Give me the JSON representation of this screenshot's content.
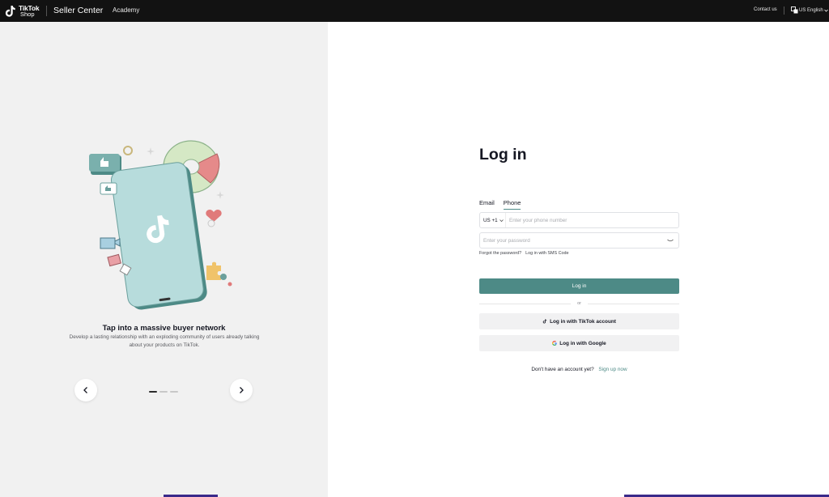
{
  "header": {
    "brand_line1": "TikTok",
    "brand_line2": "Shop",
    "product": "Seller Center",
    "academy": "Academy",
    "contact": "Contact us",
    "language": "US English"
  },
  "carousel": {
    "title": "Tap into a massive buyer network",
    "description": "Develop a lasting relationship with an exploding community of users already talking about your products on TikTok.",
    "prev_icon": "chevron-left-icon",
    "next_icon": "chevron-right-icon",
    "slide_count": 3,
    "active_slide": 1
  },
  "login": {
    "title": "Log in",
    "tabs": [
      {
        "label": "Email",
        "active": false
      },
      {
        "label": "Phone",
        "active": true
      }
    ],
    "country_code": "US +1",
    "phone_placeholder": "Enter your phone number",
    "password_placeholder": "Enter your password",
    "forgot": "Forgot the password?",
    "sms": "Log in with SMS Code",
    "submit": "Log in",
    "or": "or",
    "tiktok_login": "Log in with TikTok account",
    "google_login": "Log in with Google",
    "no_account": "Don't have an account yet?",
    "signup": "Sign up now"
  },
  "colors": {
    "accent": "#4d8a86",
    "topbar": "#121212",
    "left_panel": "#f1f1f1"
  }
}
